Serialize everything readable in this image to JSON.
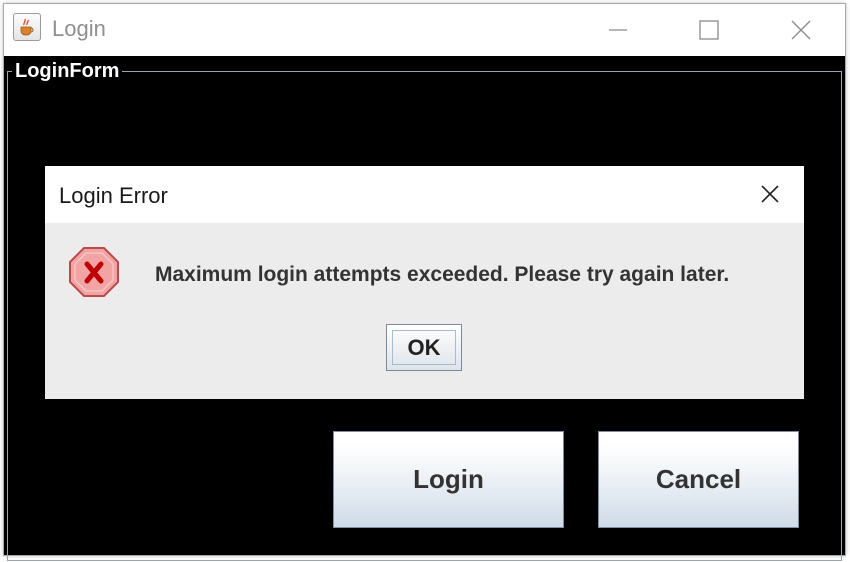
{
  "window": {
    "title": "Login",
    "app_icon": "java-cup-icon",
    "controls": [
      "minimize-icon",
      "maximize-icon",
      "close-icon"
    ]
  },
  "form": {
    "group_title": "LoginForm",
    "login_label": "Login",
    "cancel_label": "Cancel"
  },
  "dialog": {
    "title": "Login Error",
    "icon": "error-icon",
    "message": "Maximum login attempts exceeded. Please try again later.",
    "ok_label": "OK",
    "close_icon": "close-icon"
  },
  "colors": {
    "form_background": "#000000",
    "dialog_background": "#ececec",
    "error_icon_fill": "#f2a3a3",
    "error_icon_mark": "#c00000"
  }
}
